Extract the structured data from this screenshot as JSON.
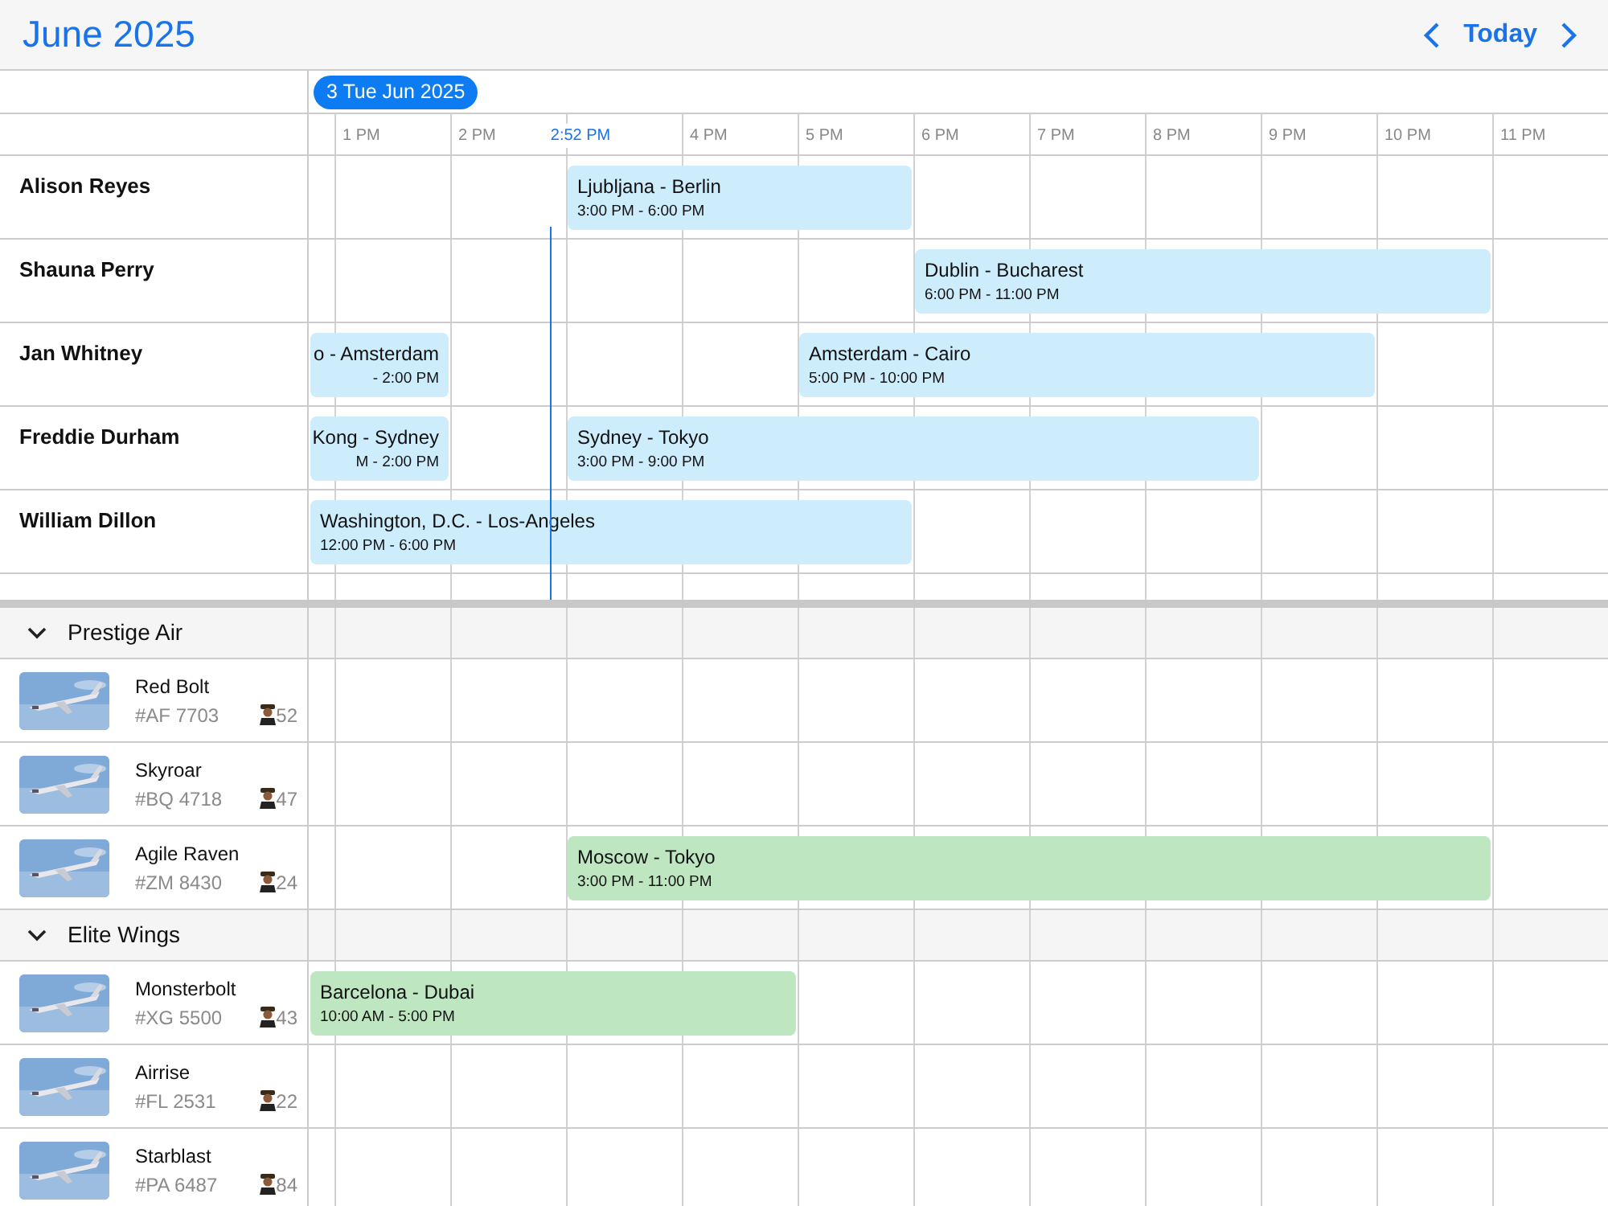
{
  "header": {
    "title": "June 2025",
    "today_button": "Today"
  },
  "date_pill": "3 Tue Jun 2025",
  "time_labels": [
    "1 PM",
    "2 PM",
    "4 PM",
    "5 PM",
    "6 PM",
    "7 PM",
    "8 PM",
    "9 PM",
    "10 PM",
    "11 PM"
  ],
  "now_marker": "2:52 PM",
  "people": [
    {
      "name": "Alison Reyes",
      "events": [
        {
          "title": "Ljubljana - Berlin",
          "time": "3:00 PM - 6:00 PM"
        }
      ]
    },
    {
      "name": "Shauna Perry",
      "events": [
        {
          "title": "Dublin - Bucharest",
          "time": "6:00 PM - 11:00 PM"
        }
      ]
    },
    {
      "name": "Jan Whitney",
      "events": [
        {
          "title": "o - Amsterdam",
          "time": "- 2:00 PM"
        },
        {
          "title": "Amsterdam - Cairo",
          "time": "5:00 PM - 10:00 PM"
        }
      ]
    },
    {
      "name": "Freddie Durham",
      "events": [
        {
          "title": "Kong - Sydney",
          "time": "M - 2:00 PM"
        },
        {
          "title": "Sydney - Tokyo",
          "time": "3:00 PM - 9:00 PM"
        }
      ]
    },
    {
      "name": "William Dillon",
      "events": [
        {
          "title": "Washington, D.C. - Los-Angeles",
          "time": "12:00 PM - 6:00 PM"
        }
      ]
    }
  ],
  "groups": [
    {
      "name": "Prestige Air",
      "expanded": true,
      "aircraft": [
        {
          "name": "Red Bolt",
          "code": "#AF 7703",
          "pilots": "52"
        },
        {
          "name": "Skyroar",
          "code": "#BQ 4718",
          "pilots": "47"
        },
        {
          "name": "Agile Raven",
          "code": "#ZM 8430",
          "pilots": "24",
          "events": [
            {
              "title": "Moscow - Tokyo",
              "time": "3:00 PM - 11:00 PM"
            }
          ]
        }
      ]
    },
    {
      "name": "Elite Wings",
      "expanded": true,
      "aircraft": [
        {
          "name": "Monsterbolt",
          "code": "#XG 5500",
          "pilots": "43",
          "events": [
            {
              "title": "Barcelona - Dubai",
              "time": "10:00 AM - 5:00 PM"
            }
          ]
        },
        {
          "name": "Airrise",
          "code": "#FL 2531",
          "pilots": "22"
        },
        {
          "name": "Starblast",
          "code": "#PA 6487",
          "pilots": "84"
        }
      ]
    }
  ]
}
